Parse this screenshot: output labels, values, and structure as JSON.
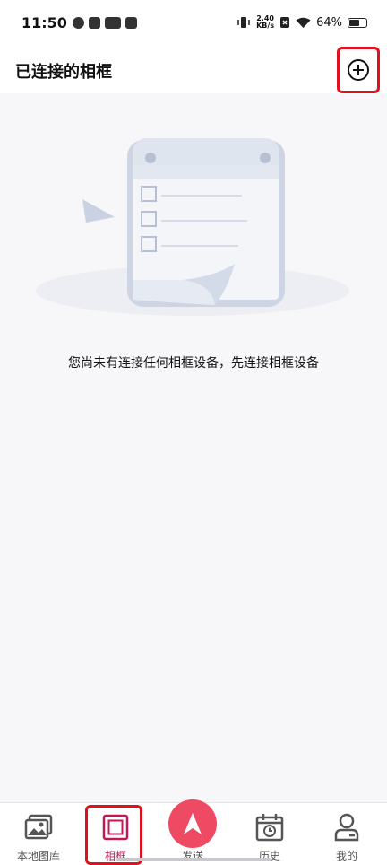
{
  "status_bar": {
    "time": "11:50",
    "speed_value": "2.40",
    "speed_unit": "KB/s",
    "battery": "64%",
    "battery_level": 0.64
  },
  "header": {
    "title": "已连接的相框",
    "add_icon": "plus-circle-icon"
  },
  "main": {
    "empty_message": "您尚未有连接任何相框设备，先连接相框设备",
    "illustration": "checklist-clipboard-illustration"
  },
  "tabs": [
    {
      "label": "本地图库",
      "icon": "gallery-icon",
      "active": false
    },
    {
      "label": "相框",
      "icon": "frame-icon",
      "active": true
    },
    {
      "label": "发送",
      "icon": "send-icon",
      "active": false
    },
    {
      "label": "历史",
      "icon": "history-icon",
      "active": false
    },
    {
      "label": "我的",
      "icon": "profile-icon",
      "active": false
    }
  ],
  "colors": {
    "accent": "#c2185b",
    "send": "#ee4a64",
    "highlight": "#e0101c"
  }
}
